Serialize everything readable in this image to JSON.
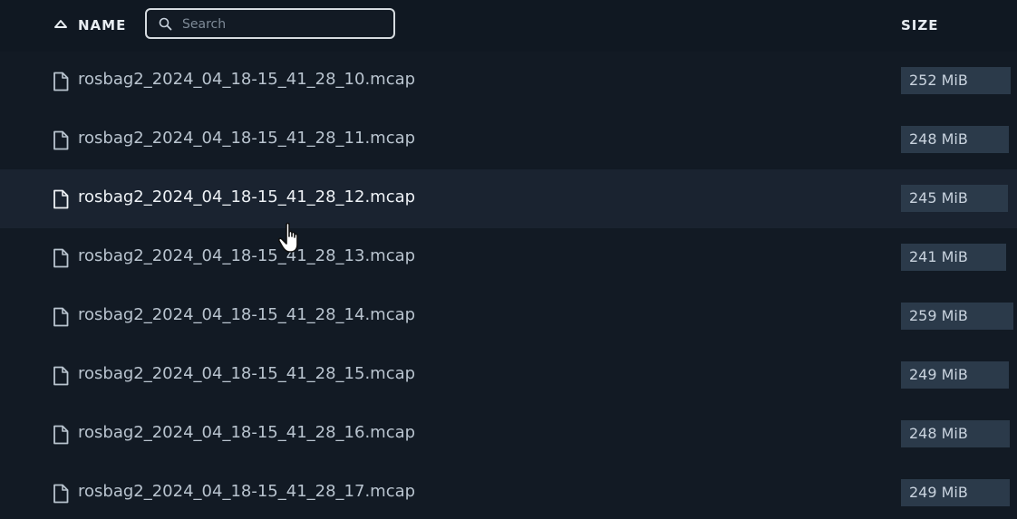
{
  "header": {
    "name_label": "NAME",
    "size_label": "SIZE",
    "search_placeholder": "Search",
    "search_value": ""
  },
  "files": [
    {
      "name": "rosbag2_2024_04_18-15_41_28_10.mcap",
      "size": "252 MiB"
    },
    {
      "name": "rosbag2_2024_04_18-15_41_28_11.mcap",
      "size": "248 MiB"
    },
    {
      "name": "rosbag2_2024_04_18-15_41_28_12.mcap",
      "size": "245 MiB"
    },
    {
      "name": "rosbag2_2024_04_18-15_41_28_13.mcap",
      "size": "241 MiB"
    },
    {
      "name": "rosbag2_2024_04_18-15_41_28_14.mcap",
      "size": "259 MiB"
    },
    {
      "name": "rosbag2_2024_04_18-15_41_28_15.mcap",
      "size": "249 MiB"
    },
    {
      "name": "rosbag2_2024_04_18-15_41_28_16.mcap",
      "size": "248 MiB"
    },
    {
      "name": "rosbag2_2024_04_18-15_41_28_17.mcap",
      "size": "249 MiB"
    }
  ],
  "hovered_index": 2,
  "icons": {
    "sort": "sort-ascending-icon",
    "search": "search-icon",
    "file": "file-icon",
    "cursor": "hand-cursor-icon"
  },
  "colors": {
    "background": "#121a24",
    "header": "#101822",
    "row_hover": "#1a2330",
    "size_badge": "#2b3a4a"
  }
}
